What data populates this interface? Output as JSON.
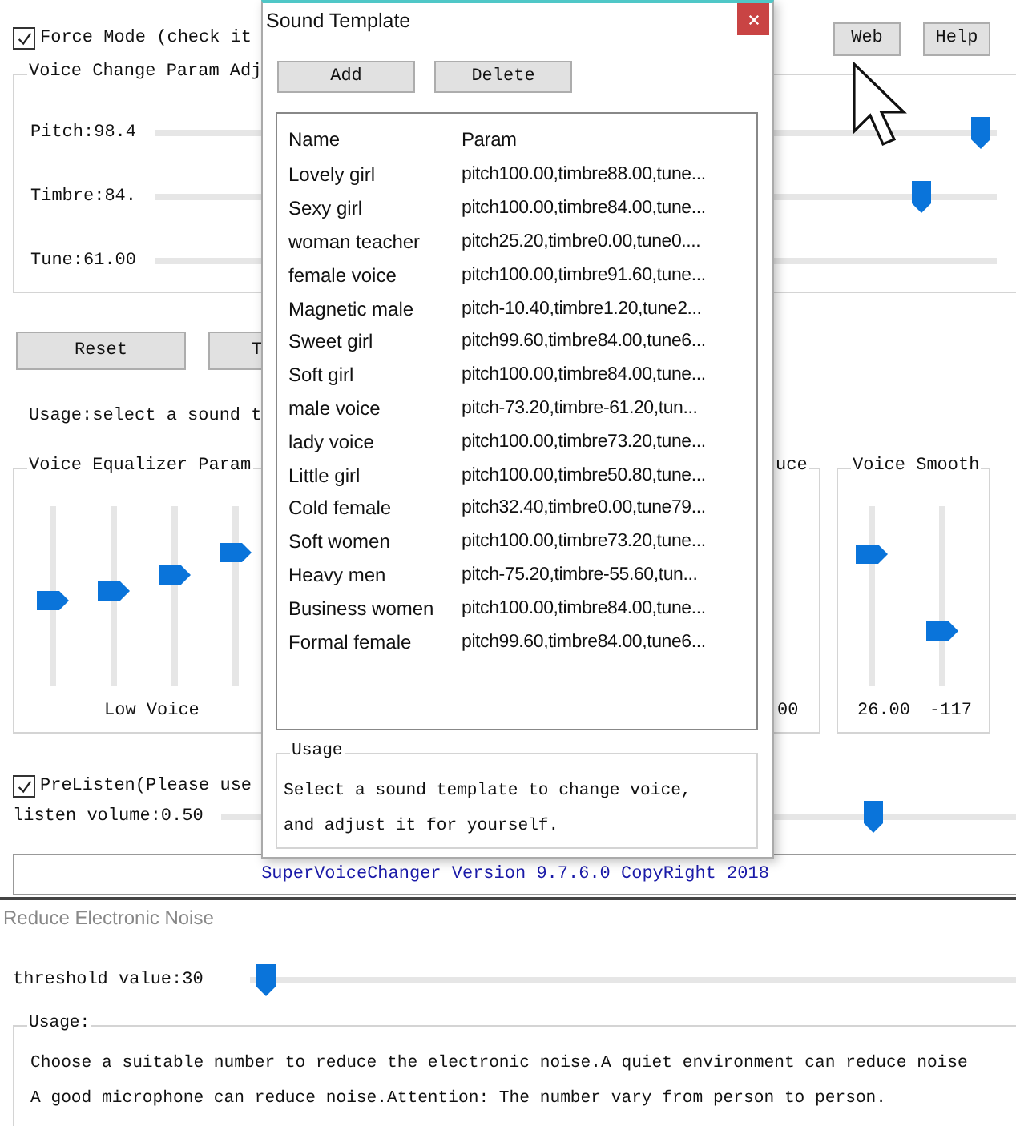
{
  "main_window": {
    "force_mode": {
      "label": "Force Mode (check it",
      "checked": true
    },
    "top_buttons": [
      "Web",
      "Help"
    ],
    "voice_change_group": {
      "title": "Voice Change Param Adj",
      "sliders": [
        {
          "label": "Pitch:98.4",
          "level": 0.98
        },
        {
          "label": "Timbre:84.",
          "level": 0.91
        },
        {
          "label": "Tune:61.00"
        }
      ]
    },
    "buttons": [
      "Reset",
      "T"
    ],
    "usage": "Usage:select a sound t",
    "equalizer_group": {
      "title": "Voice Equalizer Param",
      "sliders": [
        {
          "level": 0.47
        },
        {
          "level": 0.53
        },
        {
          "level": 0.62
        },
        {
          "level": 0.74
        }
      ],
      "caption": "Low Voice"
    },
    "partial_group": {
      "title": "uce",
      "value": "00"
    },
    "smooth_group": {
      "title": "Voice Smooth",
      "sliders": [
        {
          "level": 0.73,
          "value": "26.00"
        },
        {
          "level": 0.3,
          "value": "-117"
        }
      ]
    },
    "prelisten": {
      "label": "PreListen(Please use",
      "checked": true
    },
    "listen_volume": {
      "label": "listen volume:0.50",
      "level": 0.82
    },
    "status_bar": "SuperVoiceChanger Version 9.7.6.0 CopyRight 2018"
  },
  "dialog": {
    "title": "Sound Template",
    "buttons": [
      "Add",
      "Delete"
    ],
    "columns": [
      "Name",
      "Param"
    ],
    "rows": [
      {
        "name": "Lovely girl",
        "param": "pitch100.00,timbre88.00,tune..."
      },
      {
        "name": "Sexy girl",
        "param": "pitch100.00,timbre84.00,tune..."
      },
      {
        "name": "woman teacher",
        "param": "pitch25.20,timbre0.00,tune0...."
      },
      {
        "name": "female voice",
        "param": "pitch100.00,timbre91.60,tune..."
      },
      {
        "name": "Magnetic male",
        "param": "pitch-10.40,timbre1.20,tune2..."
      },
      {
        "name": "Sweet girl",
        "param": "pitch99.60,timbre84.00,tune6..."
      },
      {
        "name": "Soft girl",
        "param": "pitch100.00,timbre84.00,tune..."
      },
      {
        "name": "male voice",
        "param": "pitch-73.20,timbre-61.20,tun..."
      },
      {
        "name": "lady voice",
        "param": "pitch100.00,timbre73.20,tune..."
      },
      {
        "name": "Little girl",
        "param": "pitch100.00,timbre50.80,tune..."
      },
      {
        "name": "Cold female",
        "param": "pitch32.40,timbre0.00,tune79..."
      },
      {
        "name": "Soft women",
        "param": "pitch100.00,timbre73.20,tune..."
      },
      {
        "name": "Heavy men",
        "param": "pitch-75.20,timbre-55.60,tun..."
      },
      {
        "name": "Business women",
        "param": "pitch100.00,timbre84.00,tune..."
      },
      {
        "name": "Formal female",
        "param": "pitch99.60,timbre84.00,tune6..."
      }
    ],
    "usage": {
      "title": "Usage",
      "lines": [
        "Select a sound template to change voice,",
        "and adjust it for yourself."
      ]
    }
  },
  "noise_window": {
    "title": "Reduce Electronic Noise",
    "threshold": {
      "label": "threshold value:30",
      "level": 0.02
    },
    "usage": {
      "title": "Usage:",
      "lines": [
        "Choose a suitable number to reduce the electronic noise.A quiet environment can reduce noise",
        "A good microphone can reduce noise.Attention: The number vary from person to person."
      ]
    }
  }
}
